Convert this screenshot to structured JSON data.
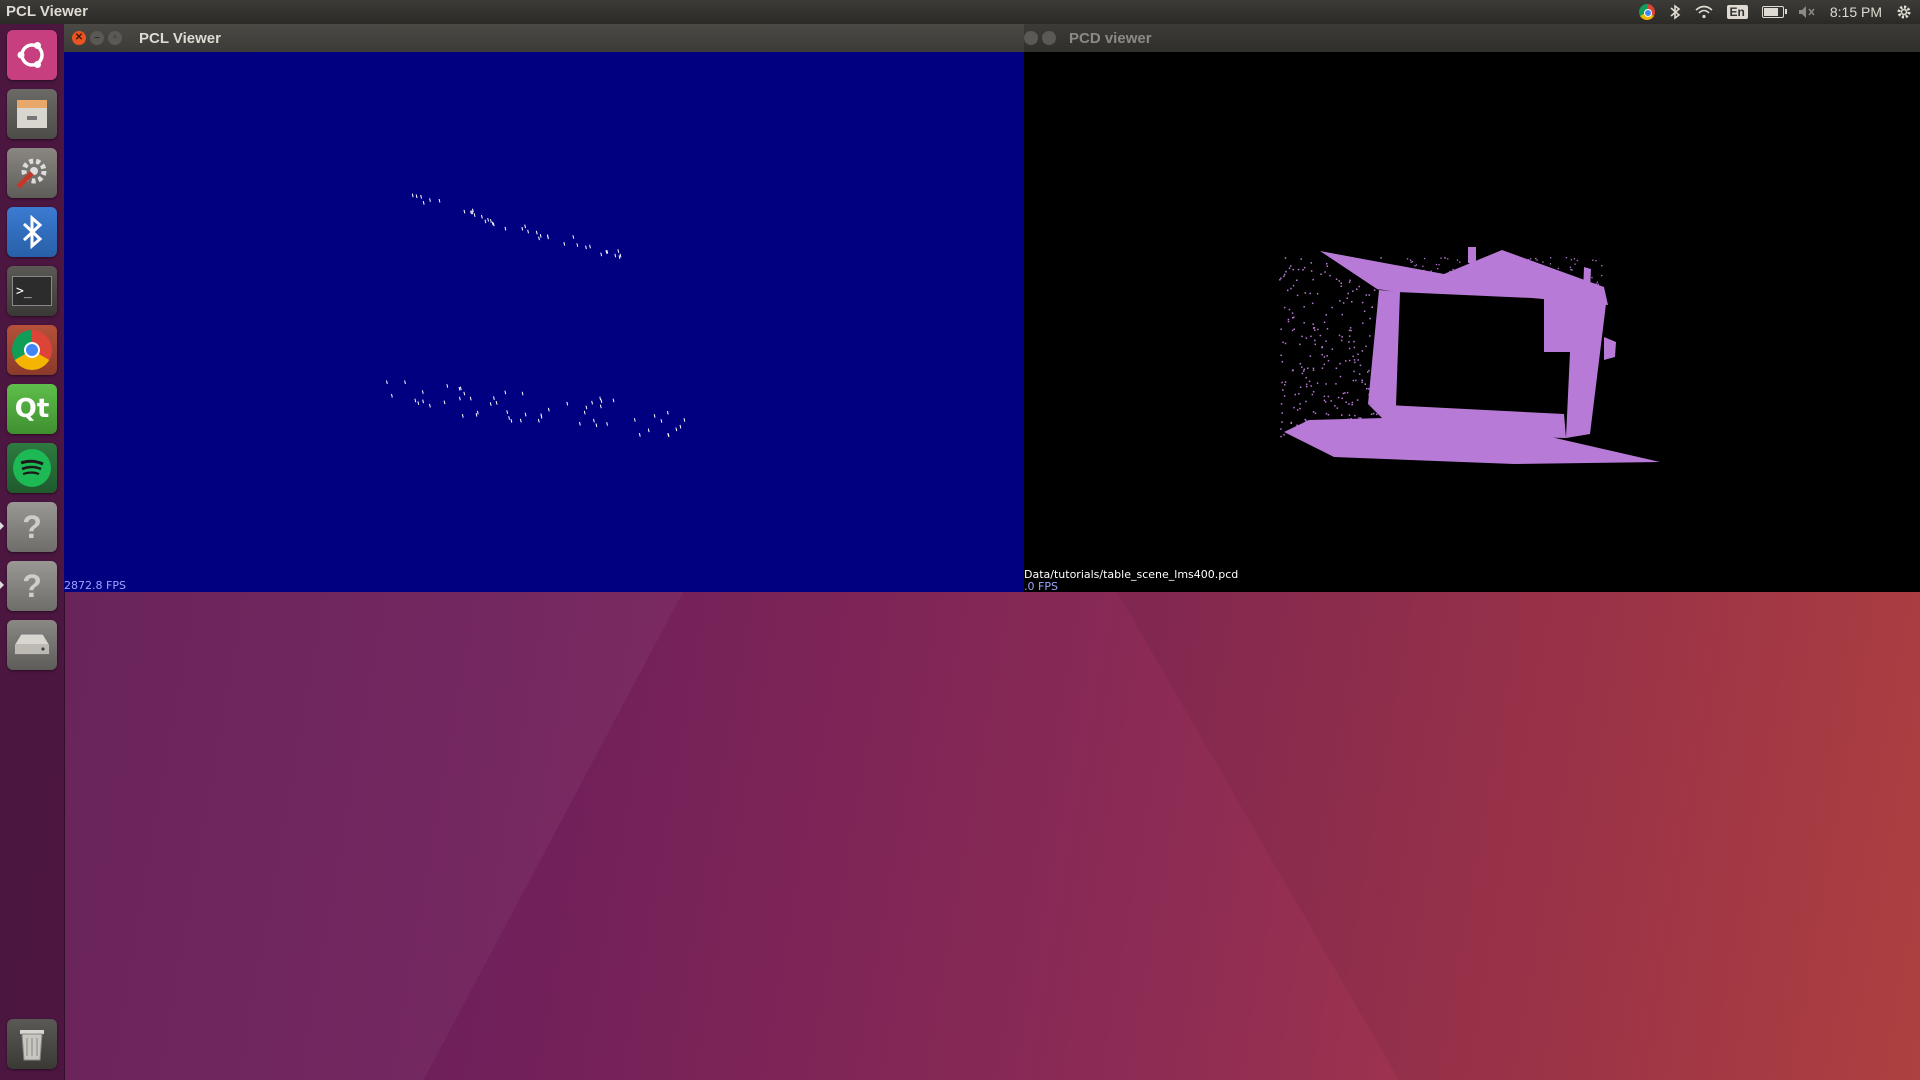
{
  "top_panel": {
    "app_title": "PCL Viewer",
    "indicators": {
      "browser_icon": "chrome-icon",
      "bluetooth_icon": "bluetooth-icon",
      "wifi_icon": "wifi-icon",
      "keyboard_layout": "En",
      "battery_icon": "battery-icon",
      "battery_level": 0.7,
      "volume_icon": "volume-muted-icon",
      "clock": "8:15 PM",
      "settings_icon": "gear-icon"
    }
  },
  "launcher": {
    "items": [
      {
        "name": "ubuntu-dash",
        "icon": "ubuntu-logo-icon"
      },
      {
        "name": "files",
        "icon": "file-cabinet-icon"
      },
      {
        "name": "system-settings",
        "icon": "settings-wrench-icon"
      },
      {
        "name": "bluetooth",
        "icon": "bluetooth-icon"
      },
      {
        "name": "terminal",
        "icon": "terminal-icon"
      },
      {
        "name": "chrome",
        "icon": "chrome-icon"
      },
      {
        "name": "qt-creator",
        "icon": "qt-icon"
      },
      {
        "name": "spotify",
        "icon": "spotify-icon"
      },
      {
        "name": "unknown-app-1",
        "icon": "question-mark-icon"
      },
      {
        "name": "unknown-app-2",
        "icon": "question-mark-icon"
      },
      {
        "name": "drive",
        "icon": "hard-drive-icon"
      },
      {
        "name": "trash",
        "icon": "trash-icon"
      }
    ],
    "terminal_prompt": ">_",
    "qt_label": "Qt",
    "question_mark": "?"
  },
  "pcl_window": {
    "title": "PCL Viewer",
    "fps_text": "2872.8 FPS",
    "background_color": "#000080",
    "point_color": "#ffffff"
  },
  "pcd_window": {
    "title": "PCD viewer",
    "file_path": "Data/tutorials/table_scene_lms400.pcd",
    "fps_text": ".0 FPS",
    "background_color": "#000000",
    "point_color": "#b77ad6"
  },
  "colors": {
    "panel": "#3c3b37",
    "close_button": "#e95420",
    "panel_text": "#dfdbd2"
  }
}
